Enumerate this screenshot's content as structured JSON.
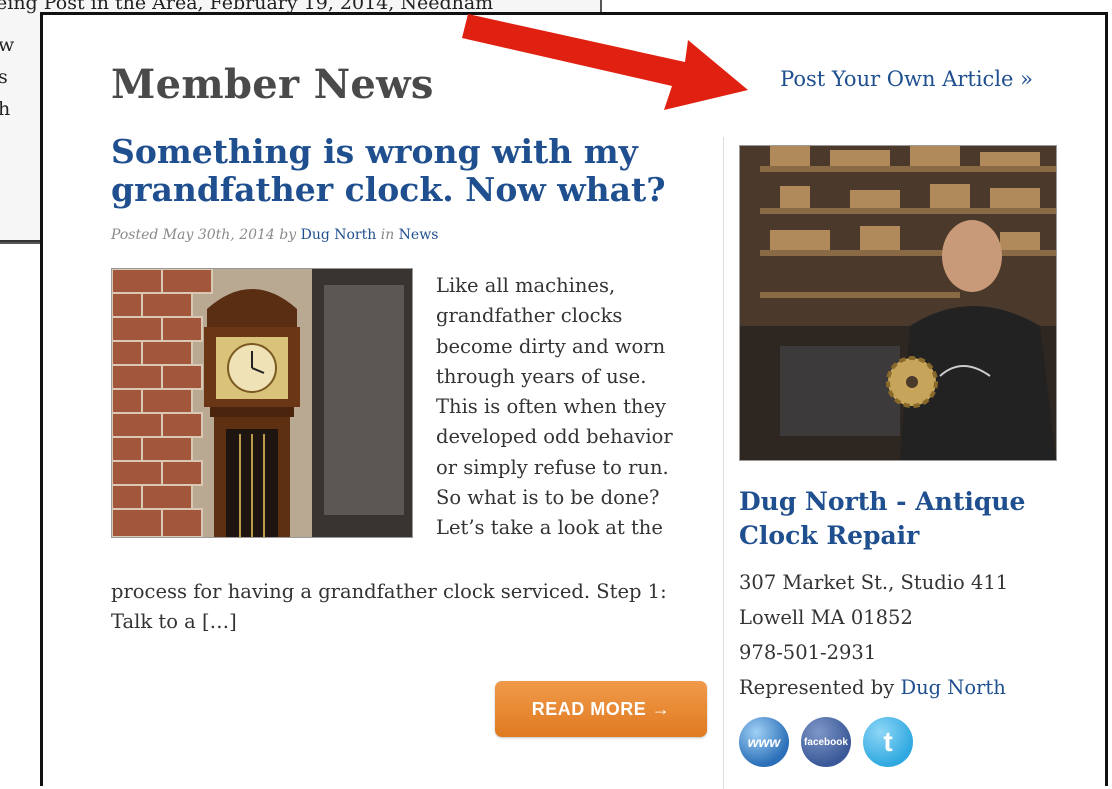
{
  "background_page": {
    "lines": [
      "eing Post in the Area, February 19, 2014, Needham",
      "w",
      "s",
      "h"
    ]
  },
  "section": {
    "title": "Member News",
    "post_own_link": "Post Your Own Article »"
  },
  "article": {
    "title": "Something is wrong with my grandfather clock. Now what?",
    "meta_prefix": "Posted May 30th, 2014 by ",
    "author": "Dug North",
    "meta_in": " in ",
    "category": "News",
    "excerpt_lines_right": [
      "Like all machines,",
      "grandfather clocks",
      "become dirty and worn",
      "through years of use.",
      "This is often when they",
      "developed odd behavior",
      "or simply refuse to run.",
      "So what is to be done?",
      "Let’s take a look at the"
    ],
    "excerpt_lines_bottom": [
      "process for having a grandfather clock serviced. Step 1:",
      "Talk to a […]"
    ],
    "read_more": "READ MORE →"
  },
  "member": {
    "name": "Dug North - Antique Clock Repair",
    "address1": "307 Market St., Studio 411",
    "address2": "Lowell MA 01852",
    "phone": "978-501-2931",
    "represented_prefix": "Represented by ",
    "represented_name": "Dug North",
    "social": [
      {
        "icon": "www-icon",
        "label": "www",
        "color": "#2b6fb8"
      },
      {
        "icon": "facebook-icon",
        "label": "facebook",
        "color": "#3b5998"
      },
      {
        "icon": "twitter-icon",
        "label": "t",
        "color": "#2fa9e0"
      }
    ]
  },
  "colors": {
    "link_blue": "#1f4f8f",
    "heading_gray": "#4a4a4a",
    "button_orange": "#e07a20",
    "annotation_arrow": "#e02010"
  }
}
